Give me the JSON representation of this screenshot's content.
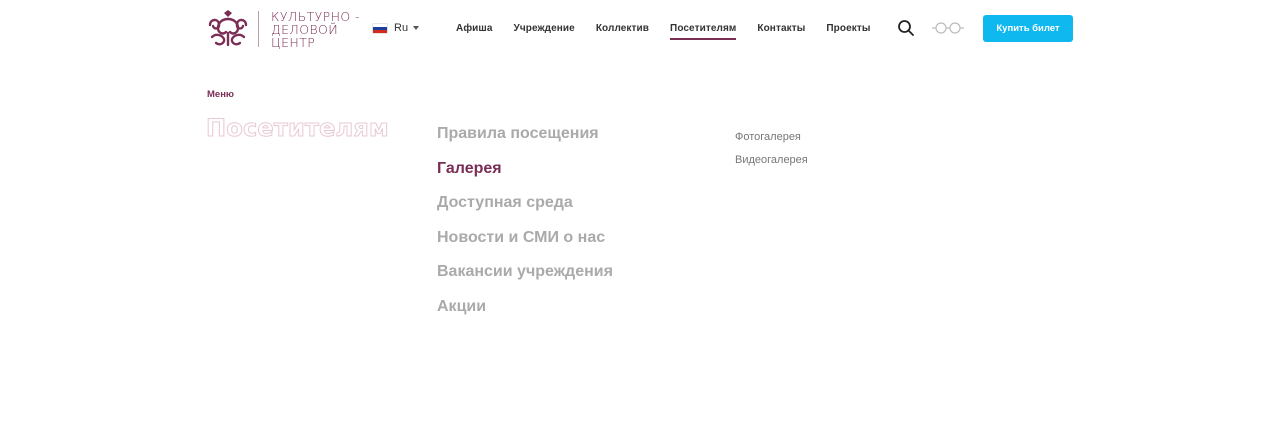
{
  "logo": {
    "lines": [
      "Культурно -",
      "деловой",
      "центр"
    ],
    "icon": "ornament-logo-icon",
    "color": "#7a2e55"
  },
  "language": {
    "selected": "Ru",
    "flag_icon": "russian-flag-icon"
  },
  "nav": {
    "items": [
      {
        "label": "Афиша",
        "active": false
      },
      {
        "label": "Учреждение",
        "active": false
      },
      {
        "label": "Коллектив",
        "active": false
      },
      {
        "label": "Посетителям",
        "active": true
      },
      {
        "label": "Контакты",
        "active": false
      },
      {
        "label": "Проекты",
        "active": false
      }
    ]
  },
  "header_icons": {
    "search": "search-icon",
    "accessibility": "glasses-icon"
  },
  "buy_button": {
    "label": "Купить билет",
    "color": "#10b8f0"
  },
  "breadcrumb": {
    "label": "Меню"
  },
  "section": {
    "title": "Посетителям"
  },
  "submenu": {
    "items": [
      {
        "label": "Правила посещения",
        "active": false
      },
      {
        "label": "Галерея",
        "active": true
      },
      {
        "label": "Доступная среда",
        "active": false
      },
      {
        "label": "Новости и СМИ о нас",
        "active": false
      },
      {
        "label": "Вакансии учреждения",
        "active": false
      },
      {
        "label": "Акции",
        "active": false
      }
    ]
  },
  "sublinks": {
    "items": [
      {
        "label": "Фотогалерея"
      },
      {
        "label": "Видеогалерея"
      }
    ]
  },
  "colors": {
    "accent": "#7a2e55",
    "muted": "#aaaaaa"
  }
}
